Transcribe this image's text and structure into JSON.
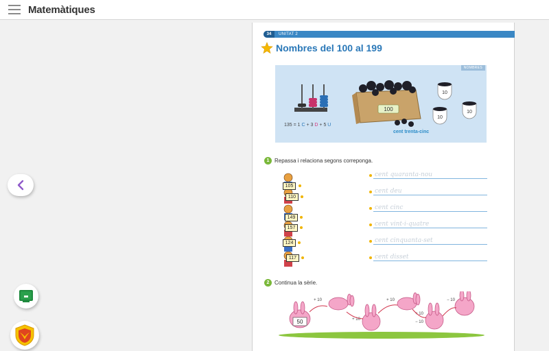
{
  "app": {
    "title": "Matemàtiques"
  },
  "page": {
    "number": "34",
    "unit": "UNITAT 2",
    "title": "Nombres del 100 al 199",
    "hero": {
      "tag": "NOMBRES",
      "formula_parts": [
        "135",
        " = 1 ",
        "C",
        " + 3 ",
        "D",
        " + 5 ",
        "U"
      ],
      "caption": "cent trenta-cinc",
      "box_label": "100",
      "cup_label": "10"
    },
    "exercise1": {
      "number": "1",
      "text": "Repassa i relaciona segons correponga.",
      "numbers": [
        "105",
        "110",
        "149",
        "157",
        "124",
        "117"
      ],
      "words": [
        "cent quaranta-nou",
        "cent deu",
        "cent cinc",
        "cent vint-i-quatre",
        "cent cinquanta-set",
        "cent disset"
      ]
    },
    "exercise2": {
      "number": "2",
      "text": "Continua la sèrie.",
      "start": "50",
      "steps": [
        "+ 10",
        "+ 10",
        "+ 10",
        "+ 10",
        "− 10",
        "− 10"
      ]
    }
  },
  "colors": {
    "accent": "#2a78b8",
    "exercise_badge": "#7ab83a",
    "hero_bg": "#cfe3f4"
  },
  "icons": {
    "menu": "hamburger-icon",
    "back": "chevron-left-icon",
    "board": "chalkboard-icon",
    "badge": "shield-badge-icon"
  }
}
